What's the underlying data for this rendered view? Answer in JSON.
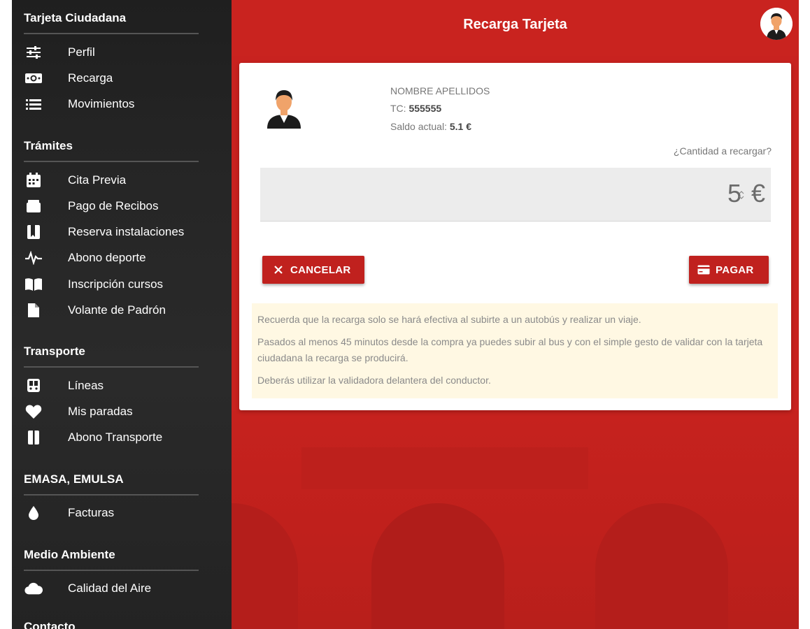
{
  "header": {
    "title": "Recarga Tarjeta",
    "avatar_icon": "user-avatar-icon"
  },
  "sidebar": {
    "sections": [
      {
        "title": "Tarjeta Ciudadana",
        "items": [
          {
            "label": "Perfil",
            "icon": "sliders-icon"
          },
          {
            "label": "Recarga",
            "icon": "money-icon"
          },
          {
            "label": "Movimientos",
            "icon": "list-icon"
          }
        ]
      },
      {
        "title": "Trámites",
        "items": [
          {
            "label": "Cita Previa",
            "icon": "calendar-icon"
          },
          {
            "label": "Pago de Recibos",
            "icon": "wallet-icon"
          },
          {
            "label": "Reserva instalaciones",
            "icon": "bookmark-icon"
          },
          {
            "label": "Abono deporte",
            "icon": "pulse-icon"
          },
          {
            "label": "Inscripción cursos",
            "icon": "book-icon"
          },
          {
            "label": "Volante de Padrón",
            "icon": "document-icon"
          }
        ]
      },
      {
        "title": "Transporte",
        "items": [
          {
            "label": "Líneas",
            "icon": "bus-icon"
          },
          {
            "label": "Mis paradas",
            "icon": "heart-icon"
          },
          {
            "label": "Abono Transporte",
            "icon": "card-icon"
          }
        ]
      },
      {
        "title": "EMASA, EMULSA",
        "items": [
          {
            "label": "Facturas",
            "icon": "water-drop-icon"
          }
        ]
      },
      {
        "title": "Medio Ambiente",
        "items": [
          {
            "label": "Calidad del Aire",
            "icon": "cloud-icon"
          }
        ]
      },
      {
        "title": "Contacto",
        "items": []
      }
    ]
  },
  "card": {
    "name": "NOMBRE APELLIDOS",
    "tc_label": "TC:",
    "tc_value": "555555",
    "balance_label": "Saldo actual:",
    "balance_value": "5.1 €",
    "amount_question": "¿Cantidad a recargar?",
    "amount_value": "5",
    "currency": "€",
    "cancel_label": "CANCELAR",
    "pay_label": "PAGAR",
    "notice": [
      "Recuerda que la recarga solo se hará efectiva al subirte a un autobús y realizar un viaje.",
      "Pasados al menos 45 minutos desde la compra ya puedes subir al bus y con el simple gesto de validar con la tarjeta ciudadana la recarga se producirá.",
      "Deberás utilizar la validadora delantera del conductor."
    ]
  },
  "colors": {
    "primary": "#c8221f",
    "button": "#c0211e",
    "sidebar": "#242424",
    "notice": "#fff8e3"
  }
}
